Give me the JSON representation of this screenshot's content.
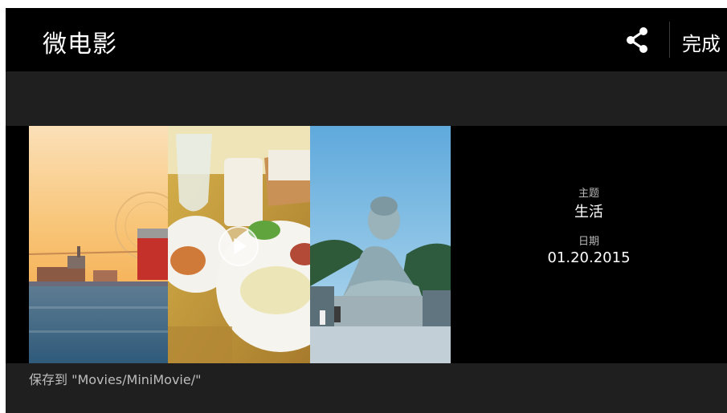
{
  "header": {
    "title": "微电影",
    "share_icon": "share-icon",
    "done_label": "完成"
  },
  "preview": {
    "thumbnails": [
      {
        "name": "harbor-photo"
      },
      {
        "name": "breakfast-photo"
      },
      {
        "name": "buddha-photo"
      }
    ],
    "play_icon": "play-icon"
  },
  "info": {
    "theme_label": "主题",
    "theme_value": "生活",
    "date_label": "日期",
    "date_value": "01.20.2015"
  },
  "footer": {
    "save_path": "保存到 \"Movies/MiniMovie/\""
  },
  "colors": {
    "bar": "#000000",
    "strip": "#1f1f1f",
    "text_primary": "#ffffff",
    "text_secondary": "#b8b8b8"
  }
}
